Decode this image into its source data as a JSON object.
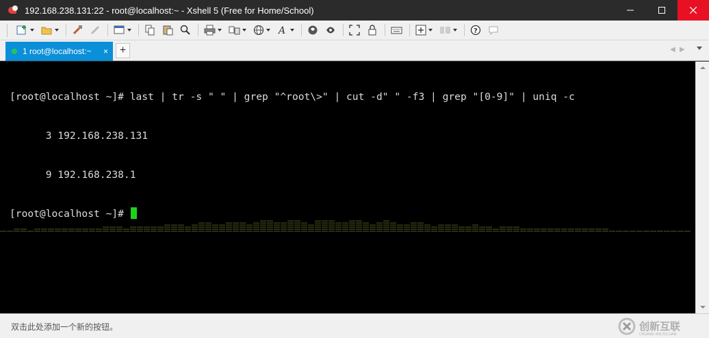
{
  "titlebar": {
    "title": "192.168.238.131:22 - root@localhost:~ - Xshell 5 (Free for Home/School)",
    "minimize": "minimize",
    "maximize": "maximize",
    "close": "close"
  },
  "toolbar": {
    "icons": [
      "new-session-icon",
      "open-folder-icon",
      "reconnect-icon",
      "disconnect-icon",
      "properties-icon",
      "copy-icon",
      "paste-icon",
      "find-icon",
      "print-icon",
      "transfer-icon",
      "globe-icon",
      "font-icon",
      "xftp-icon",
      "xmanager-icon",
      "fullscreen-icon",
      "lock-icon",
      "keyboard-icon",
      "add-button-icon",
      "layout-icon",
      "help-icon",
      "comment-icon"
    ]
  },
  "tabs": [
    {
      "label": "1 root@localhost:~",
      "active": true,
      "status_color": "#22c55e",
      "close": "×"
    }
  ],
  "tab_add": "+",
  "tab_nav": {
    "prev": "◀",
    "next": "▶"
  },
  "terminal": {
    "background": "#000000",
    "foreground": "#dcdcdc",
    "cursor_color": "#1bd21b",
    "lines": [
      "[root@localhost ~]# last | tr -s \" \" | grep \"^root\\>\" | cut -d\" \" -f3 | grep \"[0-9]\" | uniq -c",
      "      3 192.168.238.131",
      "      9 192.168.238.1",
      "[root@localhost ~]# "
    ]
  },
  "statusbar": {
    "hint": "双击此处添加一个新的按钮。"
  },
  "watermark": {
    "text": "创新互联",
    "subtext": "CHUANG XIN HU LIAN"
  },
  "colors": {
    "titlebar_bg": "#2b2b2b",
    "tab_active_bg": "#0b8fd8",
    "close_button_bg": "#e81123"
  }
}
